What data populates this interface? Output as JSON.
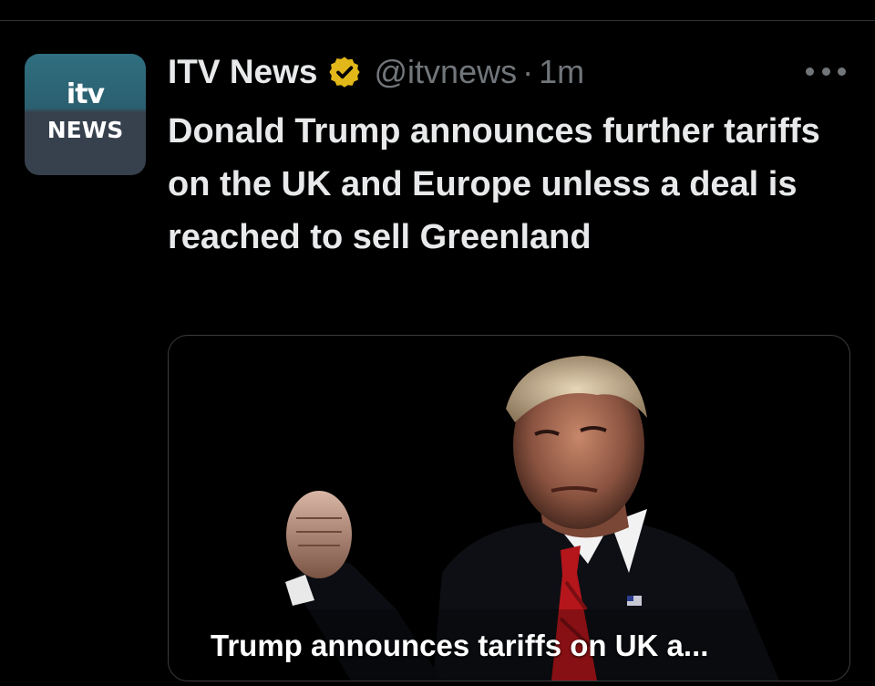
{
  "tweet": {
    "author": {
      "display_name": "ITV News",
      "handle": "@itvnews",
      "verified_badge": "gold-verified-badge-icon",
      "avatar": {
        "logo_text": "itv",
        "logo_subtext": "NEWS"
      }
    },
    "separator": "·",
    "timestamp": "1m",
    "more_icon": "more-horizontal-icon",
    "text": "Donald Trump announces further tariffs on the UK and Europe unless a deal is reached to sell Greenland",
    "media": {
      "type": "link-card-image",
      "caption": "Trump announces tariffs on UK a..."
    }
  },
  "colors": {
    "background": "#000000",
    "primary_text": "#e7e9ea",
    "secondary_text": "#71767b",
    "verified_gold": "#e2b719",
    "divider": "#2f3336"
  }
}
